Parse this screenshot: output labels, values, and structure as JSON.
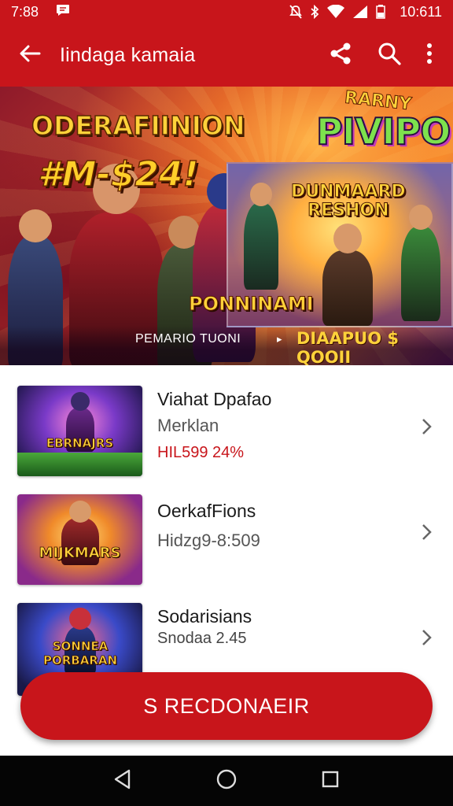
{
  "status_bar": {
    "time_left": "7:88",
    "time_right": "10:611",
    "icons": [
      "message-icon",
      "mute-icon",
      "bluetooth-icon",
      "wifi-icon",
      "signal-icon",
      "battery-icon"
    ]
  },
  "app_bar": {
    "title": "Iindaga kamaia",
    "icons": [
      "back-arrow-icon",
      "share-icon",
      "search-icon",
      "more-vert-icon"
    ]
  },
  "hero": {
    "title": "ODERAFIINION",
    "price": "#M-$24!",
    "logo_top": "RARNY",
    "logo": "PIVIPO",
    "card_title_line1": "DUNMAARD",
    "card_title_line2": "RESHON",
    "sub_logo": "PONNINAMI",
    "caption_left": "PEMARIO TUONI",
    "caption_arrow": "▸",
    "caption_right": "DIAAPUO $ QOOII"
  },
  "list": {
    "items": [
      {
        "thumb_label": "EBRNAJRS",
        "title": "Viahat Dpafao",
        "subtitle": "Merklan",
        "price": "HIL599 24%"
      },
      {
        "thumb_label": "MIJKMARS",
        "title": "OerkafFions",
        "subtitle": "Hidzg9-8:509",
        "price": ""
      },
      {
        "thumb_label": "SONNEA PORBARAN",
        "title": "Sodarisians",
        "subtitle": "Snodaa    2.45",
        "price": ""
      }
    ]
  },
  "cta": {
    "label": "S RECDONAEIR"
  },
  "nav_bar": {
    "icons": [
      "nav-back-icon",
      "nav-home-icon",
      "nav-recents-icon"
    ]
  },
  "colors": {
    "brand_red": "#c8151b",
    "nav_black": "#050505",
    "accent_gold": "#ffd23a"
  }
}
